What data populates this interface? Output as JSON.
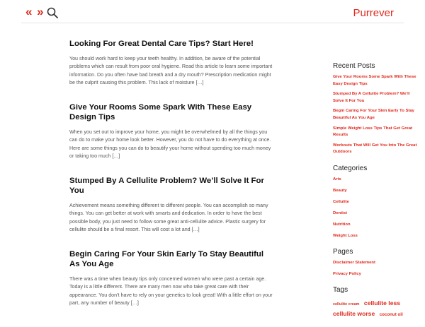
{
  "header": {
    "nav_arrows": "« »",
    "site_title": "Purrever"
  },
  "posts": [
    {
      "title": "Looking For Great Dental Care Tips? Start Here!",
      "excerpt": "You should work hard to keep your teeth healthy. In addition, be aware of the potential problems which can result from poor oral hygiene. Read this article to learn some important information. Do you often have bad breath and a dry mouth? Prescription medication might be the culprit causing this problem. This lack of moisture […]"
    },
    {
      "title": "Give Your Rooms Some Spark With These Easy Design Tips",
      "excerpt": "When you set out to improve your home, you might be overwhelmed by all the things you can do to make your home look better. However, you do not have to do everything at once. Here are some things you can do to beautify your home without spending too much money or taking too much […]"
    },
    {
      "title": "Stumped By A Cellulite Problem? We’ll Solve It For You",
      "excerpt": "Achievement means something different to different people. You can accomplish so many things. You can get better at work with smarts and dedication. In order to have the best possible body, you just need to follow some great anti-cellulite advice. Plastic surgery for cellulite should be a final resort. This will cost a lot and […]"
    },
    {
      "title": "Begin Caring For Your Skin Early To Stay Beautiful As You Age",
      "excerpt": "There was a time when beauty tips only concerned women who were past a certain age. Today is a little different. There are many men now who take great care with their appearance. You don’t have to rely on your genetics to look great! With a little effort on your part, any number of beauty […]"
    }
  ],
  "sidebar": {
    "recent_posts": {
      "title": "Recent Posts",
      "items": [
        "Give Your Rooms Some Spark With These Easy Design Tips",
        "Stumped By A Cellulite Problem? We’ll Solve It For You",
        "Begin Caring For Your Skin Early To Stay Beautiful As You Age",
        "Simple Weight Loss Tips That Get Great Results",
        "Workouts That Will Get You Into The Great Outdoors"
      ]
    },
    "categories": {
      "title": "Categories",
      "items": [
        "Arts",
        "Beauty",
        "Cellulite",
        "Dentist",
        "Nutrition",
        "Weight Loss"
      ]
    },
    "pages": {
      "title": "Pages",
      "items": [
        "Disclaimer Statement",
        "Privacy Policy"
      ]
    },
    "tags": {
      "title": "Tags",
      "items": [
        "cellulite cream",
        "cellulite less",
        "cellulite worse",
        "coconut oil"
      ]
    }
  },
  "colors": {
    "accent": "#e02a1e",
    "text": "#222222",
    "muted": "#555555"
  }
}
